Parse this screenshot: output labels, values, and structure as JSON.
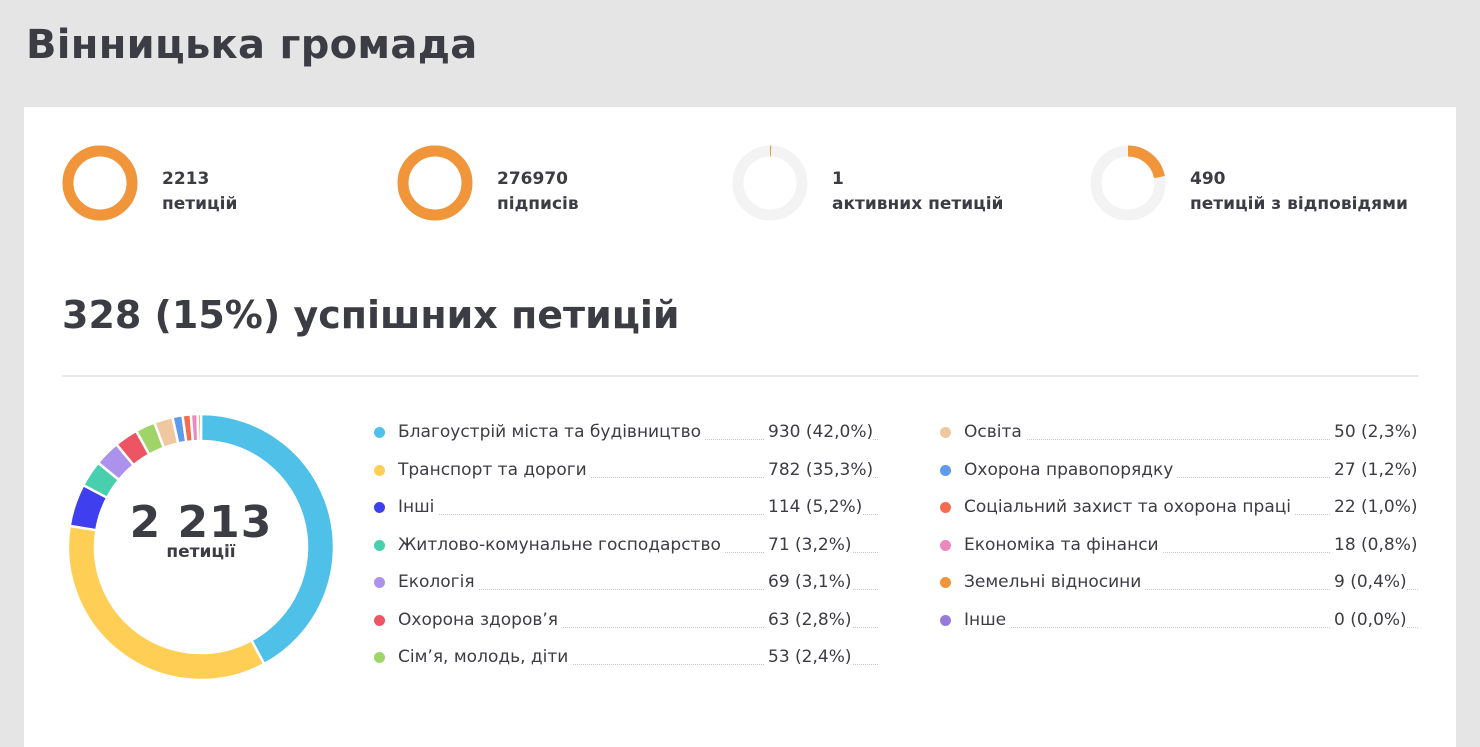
{
  "page": {
    "title": "Вінницька громада"
  },
  "stats": [
    {
      "value": "2213",
      "label": "петицій",
      "fraction": 1.0,
      "color": "#f0953a"
    },
    {
      "value": "276970",
      "label": "підписів",
      "fraction": 1.0,
      "color": "#f0953a"
    },
    {
      "value": "1",
      "label": "активних петицій",
      "fraction": 0.002,
      "color": "#f0953a"
    },
    {
      "value": "490",
      "label": "петицій з відповідями",
      "fraction": 0.22,
      "color": "#f0953a"
    }
  ],
  "success": {
    "heading": "328 (15%) успішних петицій"
  },
  "chart_data": {
    "type": "pie",
    "donut": true,
    "center": {
      "value": "2 213",
      "label": "петиції"
    },
    "categories": [
      "Благоустрій міста та будівництво",
      "Транспорт та дороги",
      "Інші",
      "Житлово-комунальне господарство",
      "Екологія",
      "Охорона здоров’я",
      "Сім’я, молодь, діти",
      "Освіта",
      "Охорона правопорядку",
      "Соціальний захист та охорона праці",
      "Економіка та фінанси",
      "Земельні відносини",
      "Інше"
    ],
    "values": [
      930,
      782,
      114,
      71,
      69,
      63,
      53,
      50,
      27,
      22,
      18,
      9,
      0
    ],
    "value_labels": [
      "930 (42,0%)",
      "782 (35,3%)",
      "114 (5,2%)",
      "71 (3,2%)",
      "69 (3,1%)",
      "63 (2,8%)",
      "53 (2,4%)",
      "50 (2,3%)",
      "27 (1,2%)",
      "22 (1,0%)",
      "18 (0,8%)",
      "9 (0,4%)",
      "0 (0,0%)"
    ],
    "colors": [
      "#4fc1e9",
      "#ffce54",
      "#3f3ff0",
      "#48cfad",
      "#ac92ec",
      "#ed5565",
      "#a0d468",
      "#f0c8a0",
      "#5d9cec",
      "#f26d50",
      "#ec87c0",
      "#f0953a",
      "#967adc"
    ]
  }
}
